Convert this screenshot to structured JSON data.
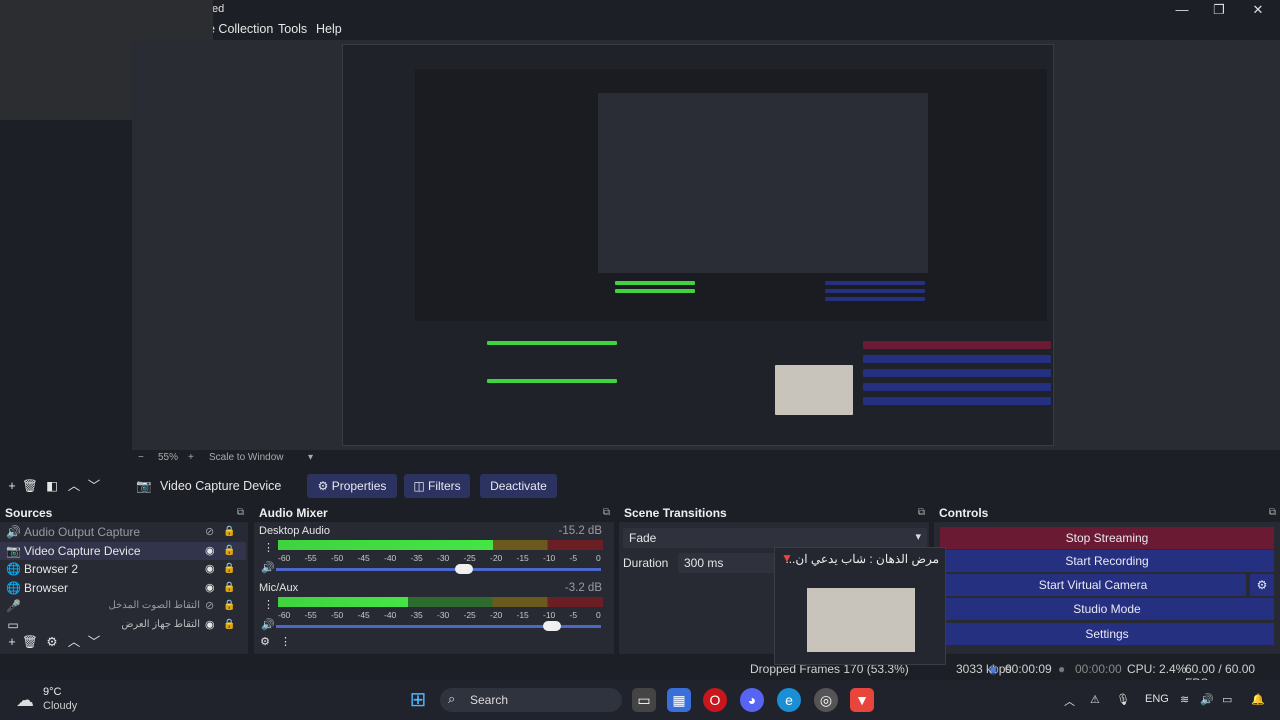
{
  "window": {
    "title_suffix": "ed",
    "minimize": "—",
    "maximize": "❐",
    "close": "✕"
  },
  "menu": {
    "scene_collection": "e Collection",
    "tools": "Tools",
    "help": "Help"
  },
  "zoom": {
    "minus": "−",
    "level": "55%",
    "plus": "+",
    "scale_mode": "Scale to Window"
  },
  "source_toolbar": {
    "selected_source": "Video Capture Device",
    "properties": "Properties",
    "filters": "Filters",
    "deactivate": "Deactivate"
  },
  "sources": {
    "title": "Sources",
    "items": [
      {
        "label": "Audio Output Capture",
        "icon": "speaker-icon",
        "hidden": true
      },
      {
        "label": "Video Capture Device",
        "icon": "camera-icon",
        "selected": true
      },
      {
        "label": "Browser 2",
        "icon": "globe-icon"
      },
      {
        "label": "Browser",
        "icon": "globe-icon"
      },
      {
        "label": "التقاط الصوت المدخل",
        "icon": "mic-icon",
        "hidden": true,
        "rtl": true
      },
      {
        "label": "التقاط جهاز العرض",
        "icon": "monitor-icon",
        "rtl": true
      }
    ]
  },
  "audio_mixer": {
    "title": "Audio Mixer",
    "channels": [
      {
        "name": "Desktop Audio",
        "db": "-15.2 dB",
        "level": 0.66,
        "volume": 0.55
      },
      {
        "name": "Mic/Aux",
        "db": "-3.2 dB",
        "level": 0.4,
        "volume": 0.82
      }
    ],
    "ticks": [
      "-60",
      "-55",
      "-50",
      "-45",
      "-40",
      "-35",
      "-30",
      "-25",
      "-20",
      "-15",
      "-10",
      "-5",
      "0"
    ]
  },
  "scene_transitions": {
    "title": "Scene Transitions",
    "transition": "Fade",
    "duration_label": "Duration",
    "duration_value": "300 ms"
  },
  "controls": {
    "title": "Controls",
    "stop_streaming": "Stop Streaming",
    "start_recording": "Start Recording",
    "start_virtual_camera": "Start Virtual Camera",
    "studio_mode": "Studio Mode",
    "settings": "Settings"
  },
  "status": {
    "dropped_frames": "Dropped Frames 170 (53.3%)",
    "bitrate": "3033 kbps",
    "stream_time": "00:00:09",
    "rec_time": "00:00:00",
    "cpu": "CPU: 2.4%",
    "fps": "60.00 / 60.00 FPS"
  },
  "notification": {
    "title": "مرض الذهان : شاب يدعي ان..."
  },
  "taskbar": {
    "weather_temp": "9°C",
    "weather_desc": "Cloudy",
    "search": "Search",
    "language": "ENG"
  },
  "colors": {
    "accent_blue": "#263081",
    "stop_red": "#6a1a33",
    "meter_green": "#3fd33f"
  }
}
